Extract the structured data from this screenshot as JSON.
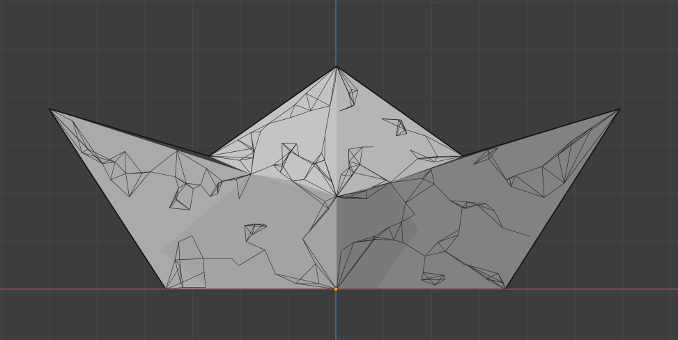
{
  "viewport": {
    "view": "front-orthographic",
    "shading": "solid",
    "overlay": "wireframe",
    "background_color": "#3d3d3d",
    "grid_color": "#474747",
    "x_axis_color": "#b8434d",
    "z_axis_color": "#3f7fbf",
    "origin_color": "#ff9a20"
  },
  "object": {
    "name_icon": "paper-boat-mesh",
    "selected": false,
    "face_colors": {
      "left_wing": "#aaaaaa",
      "center_left": "#a3a3a3",
      "center_right": "#7a7a7a",
      "right_wing": "#828282",
      "back_left": "#c4c4c4",
      "back_right": "#b5b5b5"
    }
  }
}
